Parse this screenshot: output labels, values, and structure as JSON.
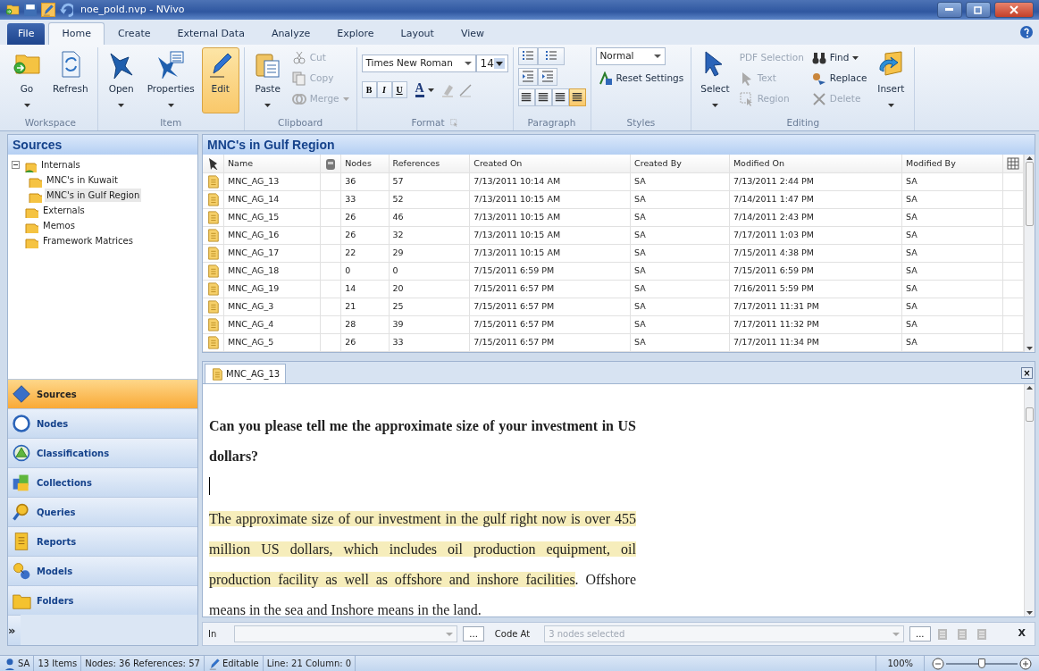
{
  "window": {
    "title": "noe_pold.nvp - NVivo"
  },
  "menu_tabs": [
    {
      "label": "File",
      "kind": "file",
      "selected": false
    },
    {
      "label": "Home",
      "kind": "tab",
      "selected": true
    },
    {
      "label": "Create",
      "kind": "tab",
      "selected": false
    },
    {
      "label": "External Data",
      "kind": "tab",
      "selected": false
    },
    {
      "label": "Analyze",
      "kind": "tab",
      "selected": false
    },
    {
      "label": "Explore",
      "kind": "tab",
      "selected": false
    },
    {
      "label": "Layout",
      "kind": "tab",
      "selected": false
    },
    {
      "label": "View",
      "kind": "tab",
      "selected": false
    }
  ],
  "ribbon": [
    {
      "label": "Workspace",
      "kind": "buttons",
      "items": [
        {
          "label": "Go",
          "kind": "large",
          "dropdown": true,
          "disabled": false,
          "active": false
        },
        {
          "label": "Refresh",
          "kind": "large",
          "dropdown": false,
          "disabled": false,
          "active": false
        }
      ]
    },
    {
      "label": "Item",
      "kind": "buttons",
      "items": [
        {
          "label": "Open",
          "kind": "large",
          "dropdown": true,
          "disabled": false,
          "active": false
        },
        {
          "label": "Properties",
          "kind": "large",
          "dropdown": true,
          "disabled": false,
          "active": false
        },
        {
          "label": "Edit",
          "kind": "large",
          "dropdown": false,
          "disabled": false,
          "active": true
        }
      ]
    },
    {
      "label": "Clipboard",
      "kind": "buttons",
      "items": [
        {
          "label": "Paste",
          "kind": "large",
          "dropdown": true,
          "disabled": false,
          "active": false
        },
        {
          "label": "Cut",
          "kind": "small",
          "dropdown": false,
          "disabled": true,
          "active": false
        },
        {
          "label": "Copy",
          "kind": "small",
          "dropdown": false,
          "disabled": true,
          "active": false
        },
        {
          "label": "Merge",
          "kind": "small",
          "dropdown": true,
          "disabled": true,
          "active": false
        }
      ]
    },
    {
      "label": "Format",
      "kind": "format",
      "font": "Times New Roman",
      "size": "14",
      "toggles": [
        "B",
        "I",
        "U"
      ],
      "color_button": "A"
    },
    {
      "label": "Paragraph",
      "kind": "paragraph",
      "aligns": [
        {
          "selected": false
        },
        {
          "selected": false
        },
        {
          "selected": false
        },
        {
          "selected": true
        }
      ]
    },
    {
      "label": "Styles",
      "kind": "styles",
      "style": "Normal",
      "items": [
        {
          "label": "Reset Settings",
          "kind": "small",
          "dropdown": false,
          "disabled": false,
          "active": false
        }
      ]
    },
    {
      "label": "Editing",
      "kind": "buttons",
      "items": [
        {
          "label": "Select",
          "kind": "large",
          "dropdown": true,
          "disabled": false,
          "active": false
        },
        {
          "label": "PDF Selection",
          "kind": "small",
          "dropdown": false,
          "disabled": true,
          "active": false
        },
        {
          "label": "Text",
          "kind": "small",
          "dropdown": false,
          "disabled": true,
          "active": false
        },
        {
          "label": "Region",
          "kind": "small",
          "dropdown": false,
          "disabled": true,
          "active": false
        },
        {
          "label": "Find",
          "kind": "small",
          "dropdown": true,
          "disabled": false,
          "active": false
        },
        {
          "label": "Replace",
          "kind": "small",
          "dropdown": false,
          "disabled": false,
          "active": false
        },
        {
          "label": "Delete",
          "kind": "small",
          "dropdown": false,
          "disabled": true,
          "active": false
        },
        {
          "label": "Insert",
          "kind": "large",
          "dropdown": true,
          "disabled": false,
          "active": false
        }
      ]
    }
  ],
  "sidebar": {
    "title": "Sources",
    "tree": [
      {
        "label": "Internals",
        "expanded": true,
        "selected": false,
        "children": [
          {
            "label": "MNC's in Kuwait",
            "selected": false
          },
          {
            "label": "MNC's in Gulf Region",
            "selected": true
          }
        ]
      },
      {
        "label": "Externals",
        "selected": false
      },
      {
        "label": "Memos",
        "selected": false
      },
      {
        "label": "Framework Matrices",
        "selected": false
      }
    ],
    "nav": [
      {
        "label": "Sources",
        "selected": true
      },
      {
        "label": "Nodes",
        "selected": false
      },
      {
        "label": "Classifications",
        "selected": false
      },
      {
        "label": "Collections",
        "selected": false
      },
      {
        "label": "Queries",
        "selected": false
      },
      {
        "label": "Reports",
        "selected": false
      },
      {
        "label": "Models",
        "selected": false
      },
      {
        "label": "Folders",
        "selected": false
      }
    ],
    "more": "»"
  },
  "list": {
    "title": "MNC's in Gulf Region",
    "columns": [
      "Name",
      "Nodes",
      "References",
      "Created On",
      "Created By",
      "Modified On",
      "Modified By"
    ],
    "rows": [
      [
        "MNC_AG_13",
        "36",
        "57",
        "7/13/2011 10:14 AM",
        "SA",
        "7/13/2011 2:44 PM",
        "SA"
      ],
      [
        "MNC_AG_14",
        "33",
        "52",
        "7/13/2011 10:15 AM",
        "SA",
        "7/14/2011 1:47 PM",
        "SA"
      ],
      [
        "MNC_AG_15",
        "26",
        "46",
        "7/13/2011 10:15 AM",
        "SA",
        "7/14/2011 2:43 PM",
        "SA"
      ],
      [
        "MNC_AG_16",
        "26",
        "32",
        "7/13/2011 10:15 AM",
        "SA",
        "7/17/2011 1:03 PM",
        "SA"
      ],
      [
        "MNC_AG_17",
        "22",
        "29",
        "7/13/2011 10:15 AM",
        "SA",
        "7/15/2011 4:38 PM",
        "SA"
      ],
      [
        "MNC_AG_18",
        "0",
        "0",
        "7/15/2011 6:59 PM",
        "SA",
        "7/15/2011 6:59 PM",
        "SA"
      ],
      [
        "MNC_AG_19",
        "14",
        "20",
        "7/15/2011 6:57 PM",
        "SA",
        "7/16/2011 5:59 PM",
        "SA"
      ],
      [
        "MNC_AG_3",
        "21",
        "25",
        "7/15/2011 6:57 PM",
        "SA",
        "7/17/2011 11:31 PM",
        "SA"
      ],
      [
        "MNC_AG_4",
        "28",
        "39",
        "7/15/2011 6:57 PM",
        "SA",
        "7/17/2011 11:32 PM",
        "SA"
      ],
      [
        "MNC_AG_5",
        "26",
        "33",
        "7/15/2011 6:57 PM",
        "SA",
        "7/17/2011 11:34 PM",
        "SA"
      ]
    ]
  },
  "document": {
    "tab": "MNC_AG_13",
    "close": "×",
    "paragraphs": [
      {
        "kind": "heading",
        "segments": [
          {
            "text": "Can you please tell me the approximate size of your investment in US dollars?",
            "highlighted": false
          }
        ]
      },
      {
        "kind": "caret"
      },
      {
        "kind": "body",
        "segments": [
          {
            "text": "The approximate size of our investment in the gulf right now is over 455 million US dollars, which includes oil production equipment, oil production facility as well as offshore and inshore facilities",
            "highlighted": true
          },
          {
            "text": ". Offshore means in the sea and Inshore means in the land.",
            "highlighted": false
          }
        ]
      }
    ]
  },
  "code_bar": {
    "in_label": "In",
    "browse": "...",
    "code_at_label": "Code At",
    "placeholder": "3 nodes selected",
    "browse_2": "...",
    "close": "X"
  },
  "status_bar": {
    "items": [
      "SA",
      "13 Items",
      "Nodes: 36 References: 57",
      "Editable",
      "Line: 21 Column: 0"
    ],
    "zoom": "100%",
    "zoom_level": {
      "level": 0.5
    }
  }
}
